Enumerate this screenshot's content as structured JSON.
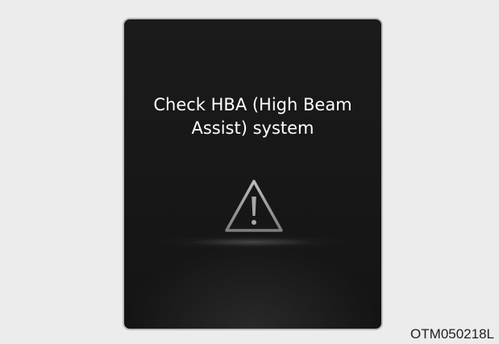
{
  "display": {
    "message_line1": "Check HBA (High Beam",
    "message_line2": "Assist) system",
    "icon": "warning-triangle-icon"
  },
  "figure_code": "OTM050218L",
  "colors": {
    "page_background": "#ececec",
    "panel_background": "#181818",
    "panel_border": "#bdbdbd",
    "message_text": "#ffffff",
    "icon_stroke": "#9a9a9a"
  }
}
